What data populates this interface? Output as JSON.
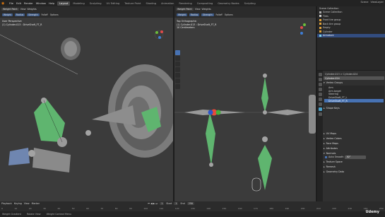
{
  "menubar": {
    "menus": [
      "File",
      "Edit",
      "Render",
      "Window",
      "Help"
    ],
    "workspace_tabs": [
      "Layout",
      "Modeling",
      "Sculpting",
      "UV Editing",
      "Texture Paint",
      "Shading",
      "Animation",
      "Rendering",
      "Compositing",
      "Geometry Nodes",
      "Scripting"
    ],
    "active_tab": "Layout",
    "scene_label": "Scene",
    "view_layer_label": "ViewLayer"
  },
  "left_viewport": {
    "mode": "Weight Paint",
    "header_items": [
      "View",
      "Weights"
    ],
    "brush_fields": [
      "Weight",
      "Radius",
      "Strength"
    ],
    "falloff": "Falloff",
    "options": "Options",
    "info_line1": "User Perspective",
    "info_line2": "(1) Cylinder.013 : DriveShaft_FT_R"
  },
  "right_viewport": {
    "mode": "Weight Paint",
    "header_items": [
      "View",
      "Weights"
    ],
    "brush_fields": [
      "Weight",
      "Radius",
      "Strength"
    ],
    "falloff": "Falloff",
    "options": "Options",
    "info_line1": "Top Orthographic",
    "info_line2": "(1) Cylinder.013 : DriveShaft_FT_R",
    "info_line3": "10 Centimeters"
  },
  "outliner": {
    "header": "Scene Collection",
    "rows": [
      "Scene Collection",
      "Tires",
      "Front tire group",
      "Back tire group",
      "Empty",
      "Cylinder",
      "Armature"
    ],
    "selected_index": 6
  },
  "properties": {
    "breadcrumb": "Cylinder.013  >  Cylinder.024",
    "object_name": "Cylinder.024",
    "vertex_groups_header": "Vertex Groups",
    "vertex_groups": [
      "Arm",
      "Arm.target",
      "Steering",
      "DriveShaft_FT_L",
      "DriveShaft_FT_R"
    ],
    "selected_group_index": 4,
    "shape_keys": "Shape Keys",
    "sections": [
      "UV Maps",
      "Vertex Colors",
      "Face Maps",
      "Attributes",
      "Normals"
    ],
    "auto_smooth_label": "Auto Smooth",
    "auto_smooth_value": "30°",
    "more_sections": [
      "Texture Space",
      "Remesh",
      "Geometry Data"
    ]
  },
  "timeline": {
    "items": [
      "Playback",
      "Keying",
      "View",
      "Marker"
    ],
    "current_frame": "1",
    "start_label": "Start",
    "start": "1",
    "end_label": "End",
    "end": "250",
    "ticks": [
      "0",
      "10",
      "20",
      "30",
      "40",
      "50",
      "60",
      "70",
      "80",
      "90",
      "100",
      "110",
      "120",
      "130",
      "140",
      "150",
      "160",
      "170",
      "180",
      "190",
      "200",
      "210",
      "220",
      "230",
      "240",
      "250"
    ]
  },
  "statusbar": {
    "items": [
      "Weight Gradient",
      "Rotate View",
      "Weight Context Menu"
    ]
  },
  "watermark": "Udemy"
}
